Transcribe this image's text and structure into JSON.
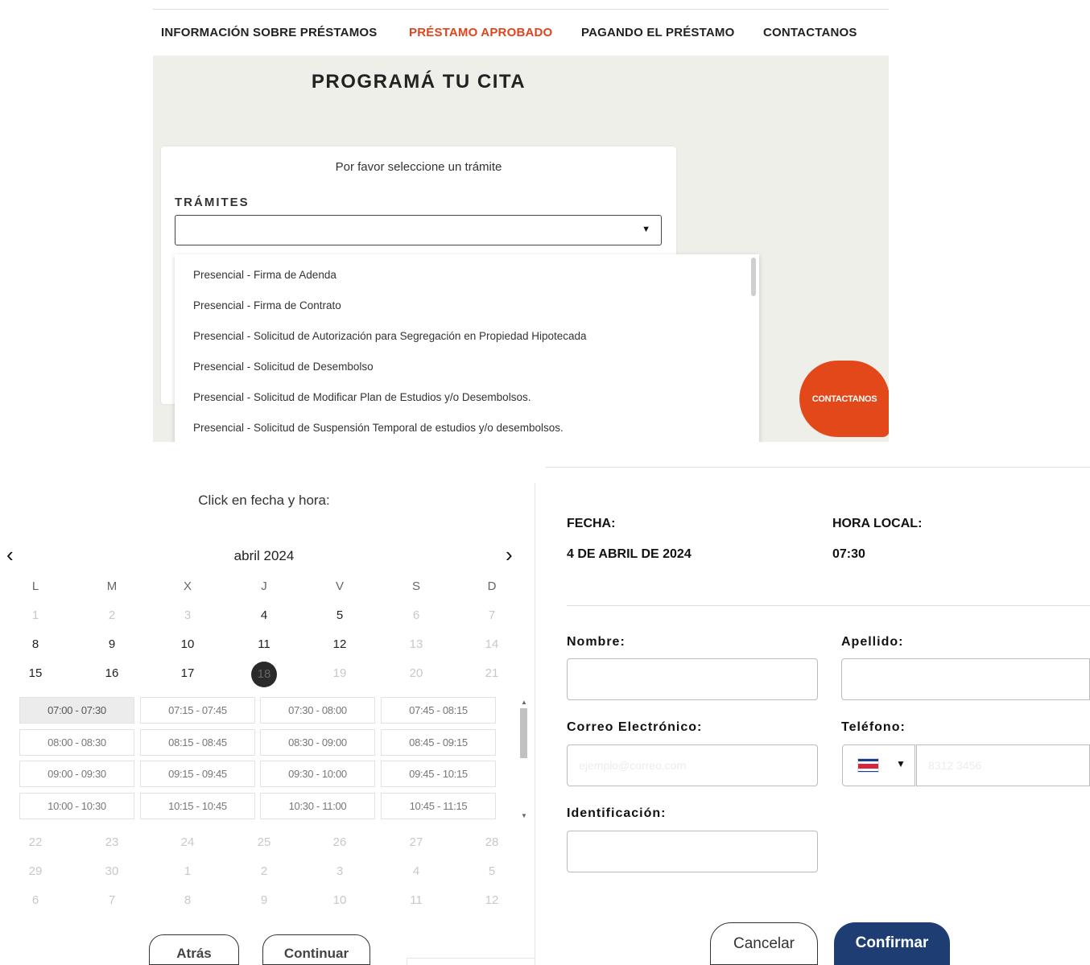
{
  "nav": {
    "items": [
      {
        "label": "INFORMACIÓN SOBRE PRÉSTAMOS",
        "active": false
      },
      {
        "label": "PRÉSTAMO APROBADO",
        "active": true
      },
      {
        "label": "PAGANDO EL PRÉSTAMO",
        "active": false
      },
      {
        "label": "CONTACTANOS",
        "active": false
      }
    ],
    "active_color": "#e0441c"
  },
  "booking": {
    "title": "PROGRAMÁ TU CITA",
    "prompt": "Por favor seleccione un trámite",
    "tramites_label": "TRÁMITES",
    "select_value": "",
    "options": [
      "Presencial - Firma de Adenda",
      "Presencial - Firma de Contrato",
      "Presencial - Solicitud de Autorización para Segregación en Propiedad Hipotecada",
      "Presencial - Solicitud de Desembolso",
      "Presencial - Solicitud de Modificar Plan de Estudios y/o Desembolsos.",
      "Presencial - Solicitud de Suspensión Temporal de estudios y/o desembolsos."
    ],
    "contact_bubble": "CONTACTANOS",
    "contact_color": "#e2481a"
  },
  "calendar": {
    "instruction": "Click en fecha y hora:",
    "month": "abril 2024",
    "prev_icon": "chevron-left-icon",
    "next_icon": "chevron-right-icon",
    "weekdays": [
      "L",
      "M",
      "X",
      "J",
      "V",
      "S",
      "D"
    ],
    "weeks": [
      [
        {
          "d": "1",
          "s": "faded"
        },
        {
          "d": "2",
          "s": "faded"
        },
        {
          "d": "3",
          "s": "faded"
        },
        {
          "d": "4",
          "s": "available"
        },
        {
          "d": "5",
          "s": "available"
        },
        {
          "d": "6",
          "s": "faded"
        },
        {
          "d": "7",
          "s": "faded"
        }
      ],
      [
        {
          "d": "8",
          "s": "available"
        },
        {
          "d": "9",
          "s": "available"
        },
        {
          "d": "10",
          "s": "available"
        },
        {
          "d": "11",
          "s": "available"
        },
        {
          "d": "12",
          "s": "available"
        },
        {
          "d": "13",
          "s": "faded"
        },
        {
          "d": "14",
          "s": "faded"
        }
      ],
      [
        {
          "d": "15",
          "s": "available"
        },
        {
          "d": "16",
          "s": "available"
        },
        {
          "d": "17",
          "s": "available"
        },
        {
          "d": "18",
          "s": "selected"
        },
        {
          "d": "19",
          "s": "faded"
        },
        {
          "d": "20",
          "s": "faded"
        },
        {
          "d": "21",
          "s": "faded"
        }
      ],
      [
        {
          "d": "22",
          "s": "faded"
        },
        {
          "d": "23",
          "s": "faded"
        },
        {
          "d": "24",
          "s": "faded"
        },
        {
          "d": "25",
          "s": "faded"
        },
        {
          "d": "26",
          "s": "faded"
        },
        {
          "d": "27",
          "s": "faded"
        },
        {
          "d": "28",
          "s": "faded"
        }
      ],
      [
        {
          "d": "29",
          "s": "faded"
        },
        {
          "d": "30",
          "s": "faded"
        },
        {
          "d": "1",
          "s": "faded"
        },
        {
          "d": "2",
          "s": "faded"
        },
        {
          "d": "3",
          "s": "faded"
        },
        {
          "d": "4",
          "s": "faded"
        },
        {
          "d": "5",
          "s": "faded"
        }
      ],
      [
        {
          "d": "6",
          "s": "faded"
        },
        {
          "d": "7",
          "s": "faded"
        },
        {
          "d": "8",
          "s": "faded"
        },
        {
          "d": "9",
          "s": "faded"
        },
        {
          "d": "10",
          "s": "faded"
        },
        {
          "d": "11",
          "s": "faded"
        },
        {
          "d": "12",
          "s": "faded"
        }
      ]
    ],
    "time_slots": [
      [
        "07:00 - 07:30",
        "07:15 - 07:45",
        "07:30 - 08:00",
        "07:45 - 08:15"
      ],
      [
        "08:00 - 08:30",
        "08:15 - 08:45",
        "08:30 - 09:00",
        "08:45 - 09:15"
      ],
      [
        "09:00 - 09:30",
        "09:15 - 09:45",
        "09:30 - 10:00",
        "09:45 - 10:15"
      ],
      [
        "10:00 - 10:30",
        "10:15 - 10:45",
        "10:30 - 11:00",
        "10:45 - 11:15"
      ]
    ],
    "active_slot": "07:00 - 07:30",
    "back_label": "Atrás",
    "continue_label": "Continuar"
  },
  "form": {
    "fecha_label": "FECHA:",
    "fecha_value": "4 DE ABRIL DE 2024",
    "hora_label": "HORA LOCAL:",
    "hora_value": "07:30",
    "nombre_label": "Nombre:",
    "nombre_value": "",
    "apellido_label": "Apellido:",
    "apellido_value": "",
    "correo_label": "Correo Electrónico:",
    "correo_placeholder": "ejemplo@correo.com",
    "telefono_label": "Teléfono:",
    "telefono_placeholder": "8312 3456",
    "country_icon": "costa-rica-flag-icon",
    "identificacion_label": "Identificación:",
    "identificacion_value": "",
    "cancel_label": "Cancelar",
    "confirm_label": "Confirmar",
    "confirm_color": "#1d3d73"
  }
}
